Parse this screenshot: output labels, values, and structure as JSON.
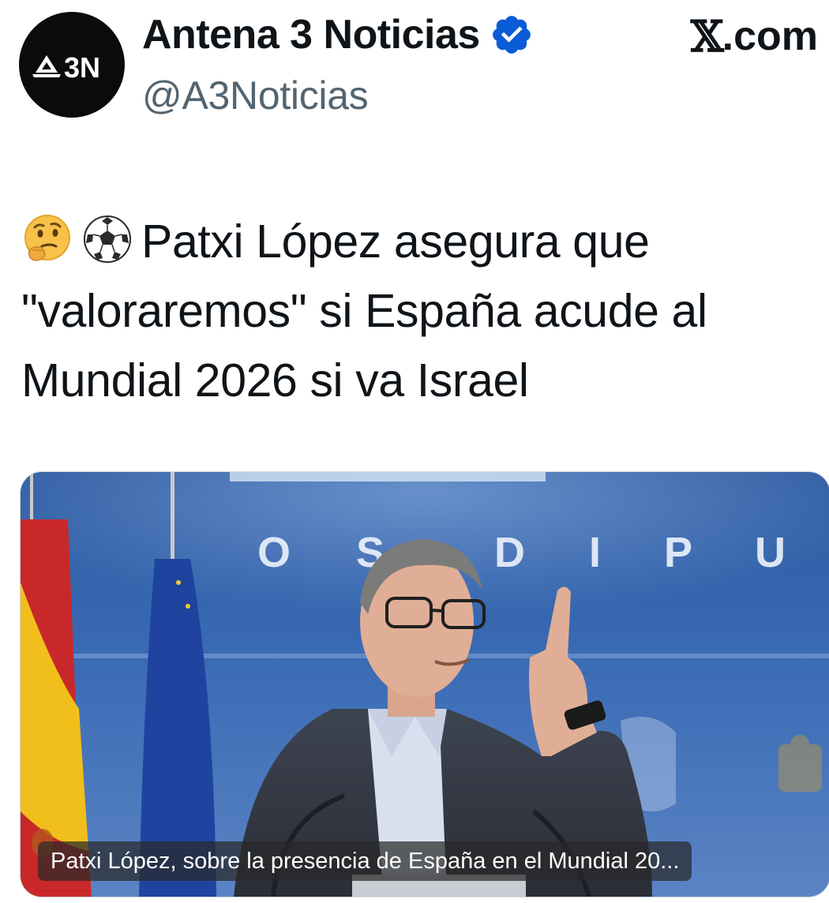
{
  "account": {
    "avatar_text": "3N",
    "display_name": "Antena 3 Noticias",
    "handle": "@A3Noticias",
    "verified": true,
    "verified_color": "#0a5bd6"
  },
  "site_mark": {
    "x": "𝕏",
    "suffix": ".com"
  },
  "tweet": {
    "emojis": [
      "thinking-face",
      "soccer-ball"
    ],
    "line1": "Patxi López asegura que",
    "line2": "\"valoraremos\" si España acude al",
    "line3": "Mundial 2026 si va Israel"
  },
  "media": {
    "wall_letters": [
      "O",
      "S",
      "D",
      "I",
      "P",
      "U"
    ],
    "caption": "Patxi López, sobre la presencia de España en el Mundial 20..."
  },
  "colors": {
    "text": "#0f1419",
    "secondary": "#536471",
    "backdrop_blue": "#2f5fa8"
  }
}
